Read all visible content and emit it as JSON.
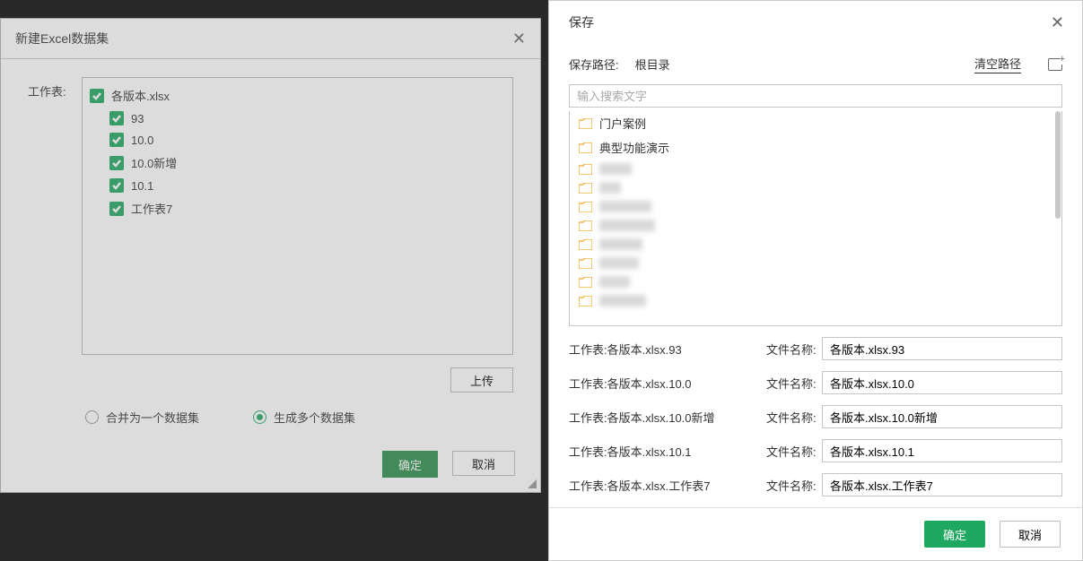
{
  "left_dialog": {
    "title": "新建Excel数据集",
    "worksheet_label": "工作表:",
    "tree": {
      "root": "各版本.xlsx",
      "children": [
        "93",
        "10.0",
        "10.0新增",
        "10.1",
        "工作表7"
      ]
    },
    "upload_label": "上传",
    "radio_merge": "合并为一个数据集",
    "radio_multi": "生成多个数据集",
    "radio_selected": "multi",
    "ok_label": "确定",
    "cancel_label": "取消"
  },
  "right_dialog": {
    "title": "保存",
    "save_path_label": "保存路径:",
    "root_label": "根目录",
    "clear_path_label": "清空路径",
    "search_placeholder": "输入搜索文字",
    "folders_named": [
      "门户案例",
      "典型功能演示"
    ],
    "folders_blurred_count": 8,
    "filename_label": "文件名称:",
    "rows": [
      {
        "sheet_label": "工作表:各版本.xlsx.93",
        "name_value": "各版本.xlsx.93"
      },
      {
        "sheet_label": "工作表:各版本.xlsx.10.0",
        "name_value": "各版本.xlsx.10.0"
      },
      {
        "sheet_label": "工作表:各版本.xlsx.10.0新增",
        "name_value": "各版本.xlsx.10.0新增"
      },
      {
        "sheet_label": "工作表:各版本.xlsx.10.1",
        "name_value": "各版本.xlsx.10.1"
      },
      {
        "sheet_label": "工作表:各版本.xlsx.工作表7",
        "name_value": "各版本.xlsx.工作表7"
      }
    ],
    "ok_label": "确定",
    "cancel_label": "取消"
  }
}
